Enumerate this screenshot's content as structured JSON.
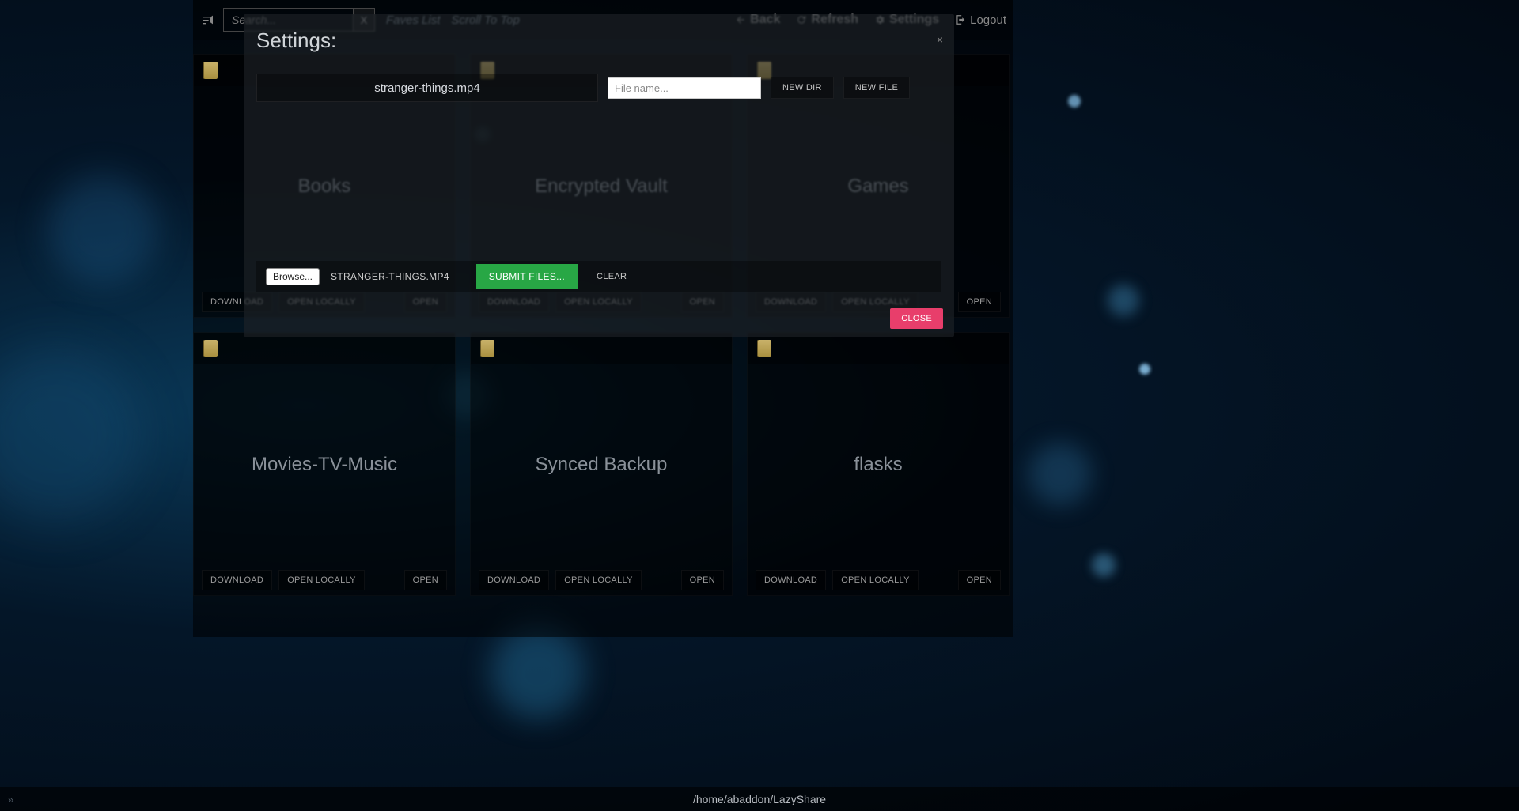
{
  "topbar": {
    "search_placeholder": "Search...",
    "clear_label": "X",
    "faves_link": "Faves List",
    "scroll_link": "Scroll To Top",
    "back_label": "Back",
    "refresh_label": "Refresh",
    "settings_label": "Settings",
    "logout_label": "Logout"
  },
  "folders": [
    {
      "name": "Books"
    },
    {
      "name": "Encrypted Vault"
    },
    {
      "name": "Games"
    },
    {
      "name": "Movies-TV-Music"
    },
    {
      "name": "Synced Backup"
    },
    {
      "name": "flasks"
    }
  ],
  "card_actions": {
    "download": "DOWNLOAD",
    "open_locally": "OPEN LOCALLY",
    "open": "OPEN"
  },
  "modal": {
    "title": "Settings:",
    "selected_file_display": "stranger-things.mp4",
    "filename_placeholder": "File name...",
    "filename_value": "",
    "new_dir_label": "NEW DIR",
    "new_file_label": "NEW FILE",
    "browse_label": "Browse...",
    "picked_file": "STRANGER-THINGS.MP4",
    "submit_label": "SUBMIT FILES...",
    "clear_label": "CLEAR",
    "close_label": "CLOSE",
    "close_x": "×"
  },
  "footer": {
    "path": "/home/abaddon/LazyShare",
    "corner": "»"
  },
  "colors": {
    "accent_green": "#28a745",
    "accent_pink": "#e83e6b",
    "bg_dark": "#020a14"
  }
}
